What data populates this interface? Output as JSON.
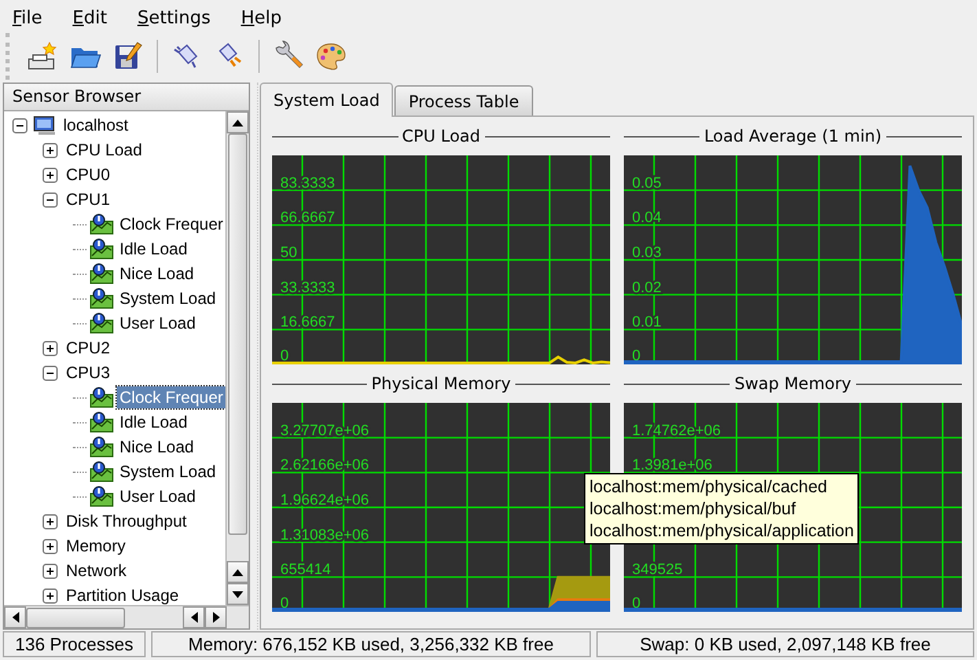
{
  "menu": [
    "File",
    "Edit",
    "Settings",
    "Help"
  ],
  "sensor_browser": {
    "title": "Sensor Browser",
    "tree": [
      {
        "label": "localhost",
        "kind": "host",
        "expanded": true,
        "selected": false,
        "children": [
          {
            "label": "CPU Load",
            "kind": "group",
            "expanded": false,
            "selected": false
          },
          {
            "label": "CPU0",
            "kind": "group",
            "expanded": false,
            "selected": false
          },
          {
            "label": "CPU1",
            "kind": "group",
            "expanded": true,
            "selected": false,
            "children": [
              {
                "label": "Clock Frequer",
                "kind": "sensor",
                "selected": false
              },
              {
                "label": "Idle Load",
                "kind": "sensor",
                "selected": false
              },
              {
                "label": "Nice Load",
                "kind": "sensor",
                "selected": false
              },
              {
                "label": "System Load",
                "kind": "sensor",
                "selected": false
              },
              {
                "label": "User Load",
                "kind": "sensor",
                "selected": false
              }
            ]
          },
          {
            "label": "CPU2",
            "kind": "group",
            "expanded": false,
            "selected": false
          },
          {
            "label": "CPU3",
            "kind": "group",
            "expanded": true,
            "selected": false,
            "children": [
              {
                "label": "Clock Frequer",
                "kind": "sensor",
                "selected": true
              },
              {
                "label": "Idle Load",
                "kind": "sensor",
                "selected": false
              },
              {
                "label": "Nice Load",
                "kind": "sensor",
                "selected": false
              },
              {
                "label": "System Load",
                "kind": "sensor",
                "selected": false
              },
              {
                "label": "User Load",
                "kind": "sensor",
                "selected": false
              }
            ]
          },
          {
            "label": "Disk Throughput",
            "kind": "group",
            "expanded": false,
            "selected": false
          },
          {
            "label": "Memory",
            "kind": "group",
            "expanded": false,
            "selected": false
          },
          {
            "label": "Network",
            "kind": "group",
            "expanded": false,
            "selected": false
          },
          {
            "label": "Partition Usage",
            "kind": "group",
            "expanded": false,
            "selected": false
          }
        ]
      }
    ]
  },
  "tabs": [
    {
      "label": "System Load",
      "selected": true
    },
    {
      "label": "Process Table",
      "selected": false
    }
  ],
  "plots": [
    {
      "chart_data": {
        "type": "line",
        "title": "CPU Load",
        "grid": true,
        "ylim": [
          0,
          100
        ],
        "yticks": [
          0,
          16.6667,
          33.3333,
          50,
          66.6667,
          83.3333
        ],
        "series": [
          {
            "color": "#e8d000",
            "values": [
              0,
              0,
              0,
              0,
              0,
              0,
              0,
              0,
              0,
              0,
              0,
              0,
              0,
              0,
              0,
              0,
              0,
              0,
              0,
              0,
              0,
              0,
              0,
              0,
              0,
              0,
              0,
              0,
              0,
              0,
              0,
              0,
              0,
              3.5,
              1,
              0.6,
              2.2,
              0.6,
              1.2,
              0.8
            ]
          }
        ]
      }
    },
    {
      "chart_data": {
        "type": "area",
        "title": "Load Average (1 min)",
        "grid": true,
        "ylim": [
          0,
          0.06
        ],
        "yticks": [
          0,
          0.01,
          0.02,
          0.03,
          0.04,
          0.05
        ],
        "series": [
          {
            "color": "#1f64c0",
            "values": [
              0,
              0,
              0,
              0,
              0,
              0,
              0,
              0,
              0,
              0,
              0,
              0,
              0,
              0,
              0,
              0,
              0,
              0,
              0,
              0,
              0,
              0,
              0,
              0,
              0,
              0,
              0,
              0,
              0,
              0,
              0,
              0,
              0,
              0.057,
              0.05,
              0.045,
              0.035,
              0.028,
              0.02,
              0.011
            ]
          }
        ]
      }
    },
    {
      "chart_data": {
        "type": "area",
        "title": "Physical Memory",
        "grid": true,
        "stacked": true,
        "ylim": [
          0,
          3932484
        ],
        "yticks": [
          0,
          {
            "value": 655414,
            "label": "655414"
          },
          {
            "value": 1310830,
            "label": "1.31083e+06"
          },
          {
            "value": 1966240,
            "label": "1.96624e+06"
          },
          {
            "value": 2621660,
            "label": "2.62166e+06"
          },
          {
            "value": 3277070,
            "label": "3.27707e+06"
          }
        ],
        "series": [
          {
            "color": "#1f64c0",
            "values": [
              0,
              0,
              0,
              0,
              0,
              0,
              0,
              0,
              0,
              0,
              0,
              0,
              0,
              0,
              0,
              0,
              0,
              0,
              0,
              0,
              0,
              0,
              0,
              0,
              0,
              0,
              0,
              0,
              0,
              0,
              0,
              0,
              0,
              180000,
              180000,
              180000,
              180000,
              180000,
              180000,
              180000
            ]
          },
          {
            "color": "#e87a10",
            "values": [
              0,
              0,
              0,
              0,
              0,
              0,
              0,
              0,
              0,
              0,
              0,
              0,
              0,
              0,
              0,
              0,
              0,
              0,
              0,
              0,
              0,
              0,
              0,
              0,
              0,
              0,
              0,
              0,
              0,
              0,
              0,
              0,
              0,
              50000,
              50000,
              50000,
              50000,
              50000,
              50000,
              50000
            ]
          },
          {
            "color": "#a59a10",
            "values": [
              0,
              0,
              0,
              0,
              0,
              0,
              0,
              0,
              0,
              0,
              0,
              0,
              0,
              0,
              0,
              0,
              0,
              0,
              0,
              0,
              0,
              0,
              0,
              0,
              0,
              0,
              0,
              0,
              0,
              0,
              0,
              0,
              0,
              420000,
              420000,
              420000,
              420000,
              420000,
              420000,
              420000
            ]
          }
        ]
      }
    },
    {
      "chart_data": {
        "type": "area",
        "title": "Swap Memory",
        "grid": true,
        "ylim": [
          0,
          2097150
        ],
        "yticks": [
          0,
          {
            "value": 349525,
            "label": "349525"
          },
          {
            "value": 1398100,
            "label": "1.3981e+06"
          },
          {
            "value": 1747620,
            "label": "1.74762e+06"
          }
        ],
        "series": [
          {
            "color": "#1f64c0",
            "values": [
              0,
              0,
              0,
              0,
              0,
              0,
              0,
              0,
              0,
              0,
              0,
              0,
              0,
              0,
              0,
              0,
              0,
              0,
              0,
              0,
              0,
              0,
              0,
              0,
              0,
              0,
              0,
              0,
              0,
              0,
              0,
              0,
              0,
              0,
              0,
              0,
              0,
              0,
              0,
              0
            ]
          }
        ]
      }
    }
  ],
  "tooltip": {
    "lines": [
      "localhost:mem/physical/cached",
      "localhost:mem/physical/buf",
      "localhost:mem/physical/application"
    ]
  },
  "status_bar": [
    "136 Processes",
    "Memory: 676,152 KB used, 3,256,332 KB free",
    "Swap: 0 KB used, 2,097,148 KB free"
  ]
}
